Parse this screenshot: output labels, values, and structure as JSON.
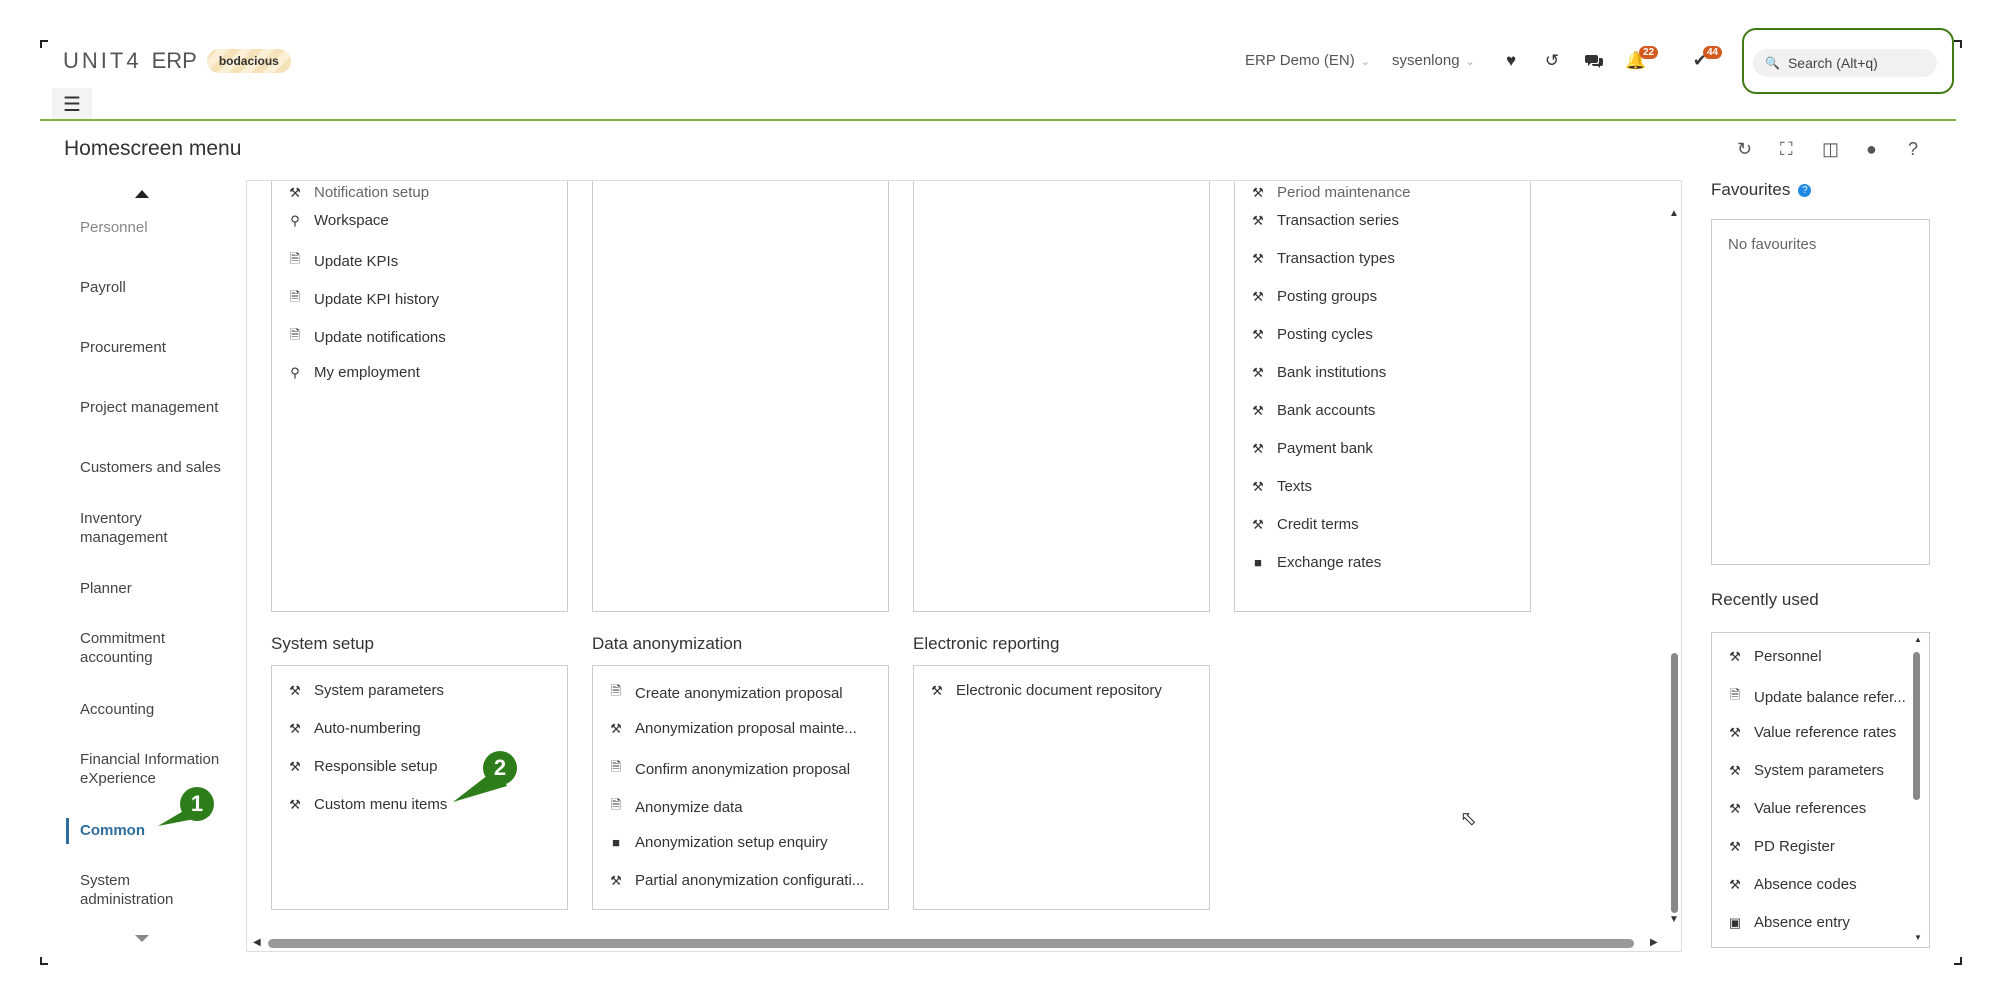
{
  "header": {
    "logo_text": "UNIT4",
    "logo_erp": "ERP",
    "env_badge": "bodacious",
    "company": "ERP Demo (EN)",
    "user": "sysenlong",
    "notifications_count": "22",
    "tasks_count": "44",
    "search_placeholder": "Search (Alt+q)"
  },
  "page": {
    "title": "Homescreen menu"
  },
  "nav": {
    "items": [
      {
        "label": "Personnel"
      },
      {
        "label": "Payroll"
      },
      {
        "label": "Procurement"
      },
      {
        "label": "Project management"
      },
      {
        "label": "Customers and sales"
      },
      {
        "label": "Inventory management"
      },
      {
        "label": "Planner"
      },
      {
        "label": "Commitment accounting"
      },
      {
        "label": "Accounting"
      },
      {
        "label": "Financial Information eXperience"
      },
      {
        "label": "Common"
      },
      {
        "label": "System administration"
      }
    ]
  },
  "main": {
    "col1_items": [
      "Notification setup",
      "Workspace",
      "Update KPIs",
      "Update KPI history",
      "Update notifications",
      "My employment"
    ],
    "col4_items": [
      "Period maintenance",
      "Transaction series",
      "Transaction types",
      "Posting groups",
      "Posting cycles",
      "Bank institutions",
      "Bank accounts",
      "Payment bank",
      "Texts",
      "Credit terms",
      "Exchange rates"
    ],
    "groups": [
      {
        "title": "System setup",
        "items": [
          "System parameters",
          "Auto-numbering",
          "Responsible setup",
          "Custom menu items"
        ]
      },
      {
        "title": "Data anonymization",
        "items": [
          "Create anonymization proposal",
          "Anonymization proposal mainte...",
          "Confirm anonymization proposal",
          "Anonymize data",
          "Anonymization setup enquiry",
          "Partial anonymization configurati..."
        ]
      },
      {
        "title": "Electronic reporting",
        "items": [
          "Electronic document repository"
        ]
      }
    ]
  },
  "favourites": {
    "title": "Favourites",
    "empty_text": "No favourites"
  },
  "recent": {
    "title": "Recently used",
    "items": [
      "Personnel",
      "Update balance refer...",
      "Value reference rates",
      "System parameters",
      "Value references",
      "PD Register",
      "Absence codes",
      "Absence entry"
    ]
  },
  "callouts": [
    "1",
    "2"
  ],
  "colors": {
    "accent": "#7cb342",
    "callout": "#2e7d1b",
    "active_nav": "#2e6e9e",
    "badge": "#d4591c"
  }
}
